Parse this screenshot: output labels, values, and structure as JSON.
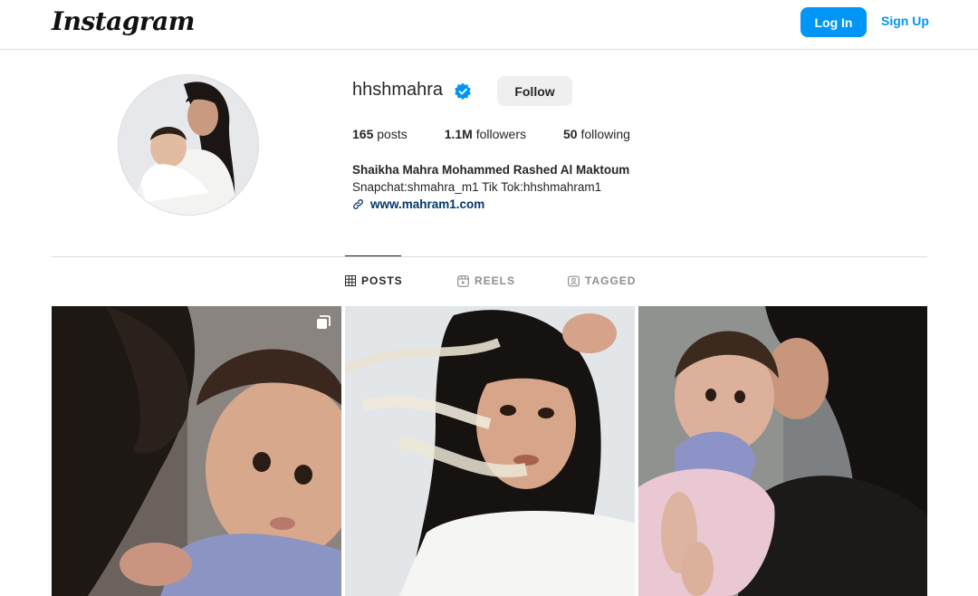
{
  "header": {
    "logo_text": "Instagram",
    "login_label": "Log In",
    "signup_label": "Sign Up"
  },
  "profile": {
    "username": "hhshmahra",
    "verified": true,
    "follow_label": "Follow",
    "stats": {
      "posts_count": "165",
      "posts_label": "posts",
      "followers_count": "1.1M",
      "followers_label": "followers",
      "following_count": "50",
      "following_label": "following"
    },
    "full_name": "Shaikha Mahra Mohammed Rashed Al Maktoum",
    "bio": "Snapchat:shmahra_m1 Tik Tok:hhshmahram1",
    "website": "www.mahram1.com"
  },
  "tabs": [
    {
      "label": "POSTS",
      "icon": "grid-icon",
      "active": true
    },
    {
      "label": "REELS",
      "icon": "reels-icon",
      "active": false
    },
    {
      "label": "TAGGED",
      "icon": "tagged-icon",
      "active": false
    }
  ],
  "posts": [
    {
      "icon": "carousel-icon",
      "has_carousel": true
    },
    {
      "has_carousel": false
    },
    {
      "has_carousel": false
    }
  ],
  "colors": {
    "accent": "#0095f6",
    "link": "#00376b",
    "verified": "#0095f6",
    "text": "#262626",
    "muted": "#8e8e8e",
    "border": "#dbdbdb"
  }
}
